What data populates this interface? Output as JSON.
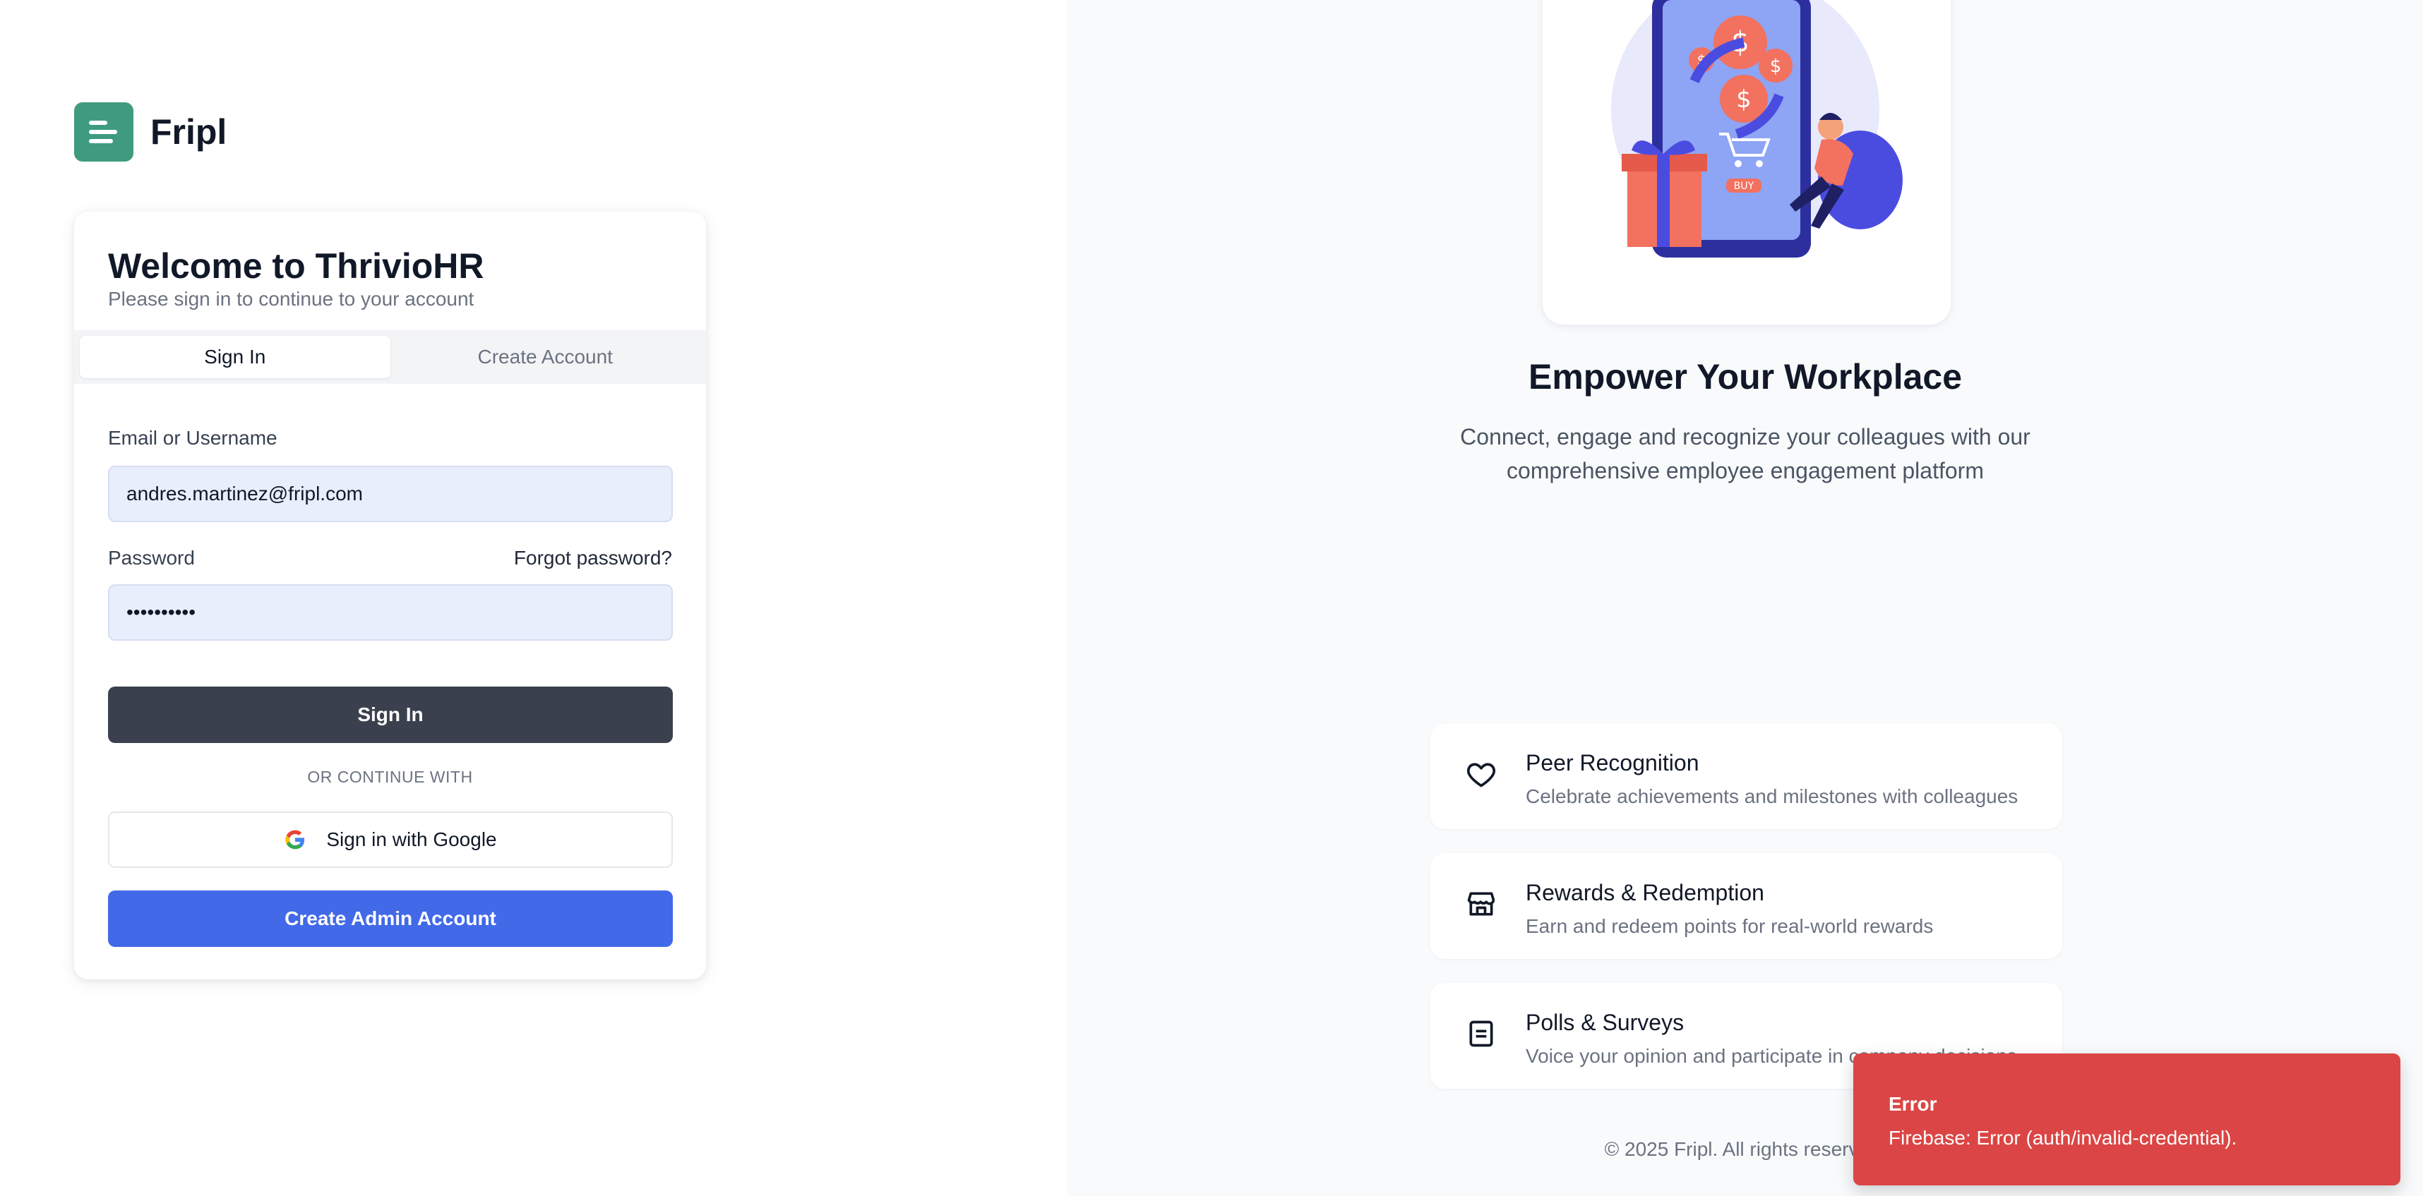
{
  "brand": {
    "name": "Fripl",
    "logo_icon": "menu-lines-icon",
    "logo_color": "#3f9b7f"
  },
  "login": {
    "title": "Welcome to ThrivioHR",
    "subtitle": "Please sign in to continue to your account",
    "tabs": [
      {
        "label": "Sign In",
        "active": true
      },
      {
        "label": "Create Account",
        "active": false
      }
    ],
    "email_label": "Email or Username",
    "email_value": "andres.martinez@fripl.com",
    "password_label": "Password",
    "forgot_label": "Forgot password?",
    "password_value": "••••••••••",
    "signin_button": "Sign In",
    "divider": "OR CONTINUE WITH",
    "google_button": "Sign in with Google",
    "admin_button": "Create Admin Account",
    "colors": {
      "primary_dark": "#3a404d",
      "accent_blue": "#4169e8"
    }
  },
  "hero": {
    "title": "Empower Your Workplace",
    "subtitle": "Connect, engage and recognize your colleagues with our comprehensive employee engagement platform",
    "illustration": "shopping-rewards-illustration",
    "illustration_badge": "BUY"
  },
  "features": [
    {
      "icon": "heart-icon",
      "title": "Peer Recognition",
      "desc": "Celebrate achievements and milestones with colleagues"
    },
    {
      "icon": "store-icon",
      "title": "Rewards & Redemption",
      "desc": "Earn and redeem points for real-world rewards"
    },
    {
      "icon": "survey-icon",
      "title": "Polls & Surveys",
      "desc": "Voice your opinion and participate in company decisions"
    }
  ],
  "footer": "© 2025 Fripl. All rights reserved.",
  "toast": {
    "title": "Error",
    "message": "Firebase: Error (auth/invalid-credential).",
    "color": "#dc4545"
  }
}
